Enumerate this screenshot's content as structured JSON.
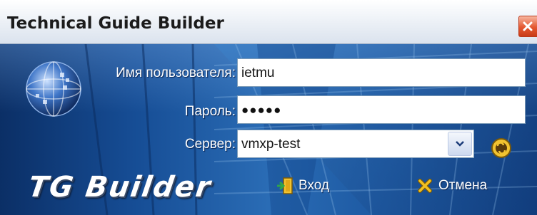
{
  "window": {
    "title": "Technical Guide Builder"
  },
  "form": {
    "username_label": "Имя пользователя:",
    "username_value": "ietmu",
    "password_label": "Пароль:",
    "password_masked": "●●●●●",
    "server_label": "Сервер:",
    "server_value": "vmxp-test"
  },
  "branding": {
    "logo_text": "TG Builder"
  },
  "actions": {
    "login_label": "Вход",
    "cancel_label": "Отмена"
  },
  "icons": {
    "close": "close-icon",
    "globe": "globe-logo-icon",
    "dropdown": "chevron-down-icon",
    "server_settings": "server-settings-icon",
    "login": "login-door-icon",
    "cancel": "cancel-x-icon"
  },
  "colors": {
    "background": "#164d95",
    "title_bar": "#eef2f7",
    "close_button": "#e4572f",
    "text_light": "#ffffff",
    "cancel_icon": "#f0c020"
  }
}
